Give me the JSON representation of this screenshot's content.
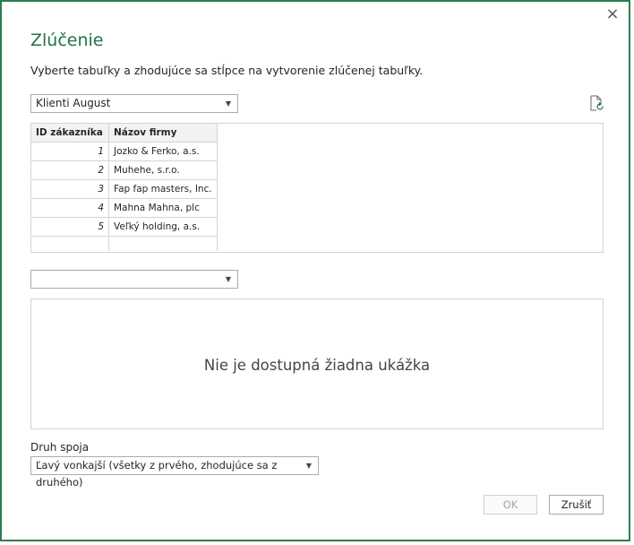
{
  "dialog": {
    "title": "Zlúčenie",
    "subtitle": "Vyberte tabuľky a zhodujúce sa stĺpce na vytvorenie zlúčenej tabuľky.",
    "close_icon": "×"
  },
  "first_table": {
    "selected": "Klienti August",
    "columns": [
      "ID zákazníka",
      "Názov firmy"
    ],
    "rows": [
      {
        "id": "1",
        "name": "Jozko & Ferko, a.s."
      },
      {
        "id": "2",
        "name": "Muhehe, s.r.o."
      },
      {
        "id": "3",
        "name": "Fap fap masters, Inc."
      },
      {
        "id": "4",
        "name": "Mahna Mahna, plc"
      },
      {
        "id": "5",
        "name": "Veľký holding, a.s."
      }
    ]
  },
  "second_table": {
    "selected": "",
    "empty_message": "Nie je dostupná žiadna ukážka"
  },
  "join": {
    "label": "Druh spoja",
    "selected": "Ľavý vonkajší (všetky z prvého, zhodujúce sa z druhého)"
  },
  "buttons": {
    "ok": "OK",
    "cancel": "Zrušiť"
  },
  "colors": {
    "accent": "#217346",
    "border": "#2e7d4f"
  }
}
